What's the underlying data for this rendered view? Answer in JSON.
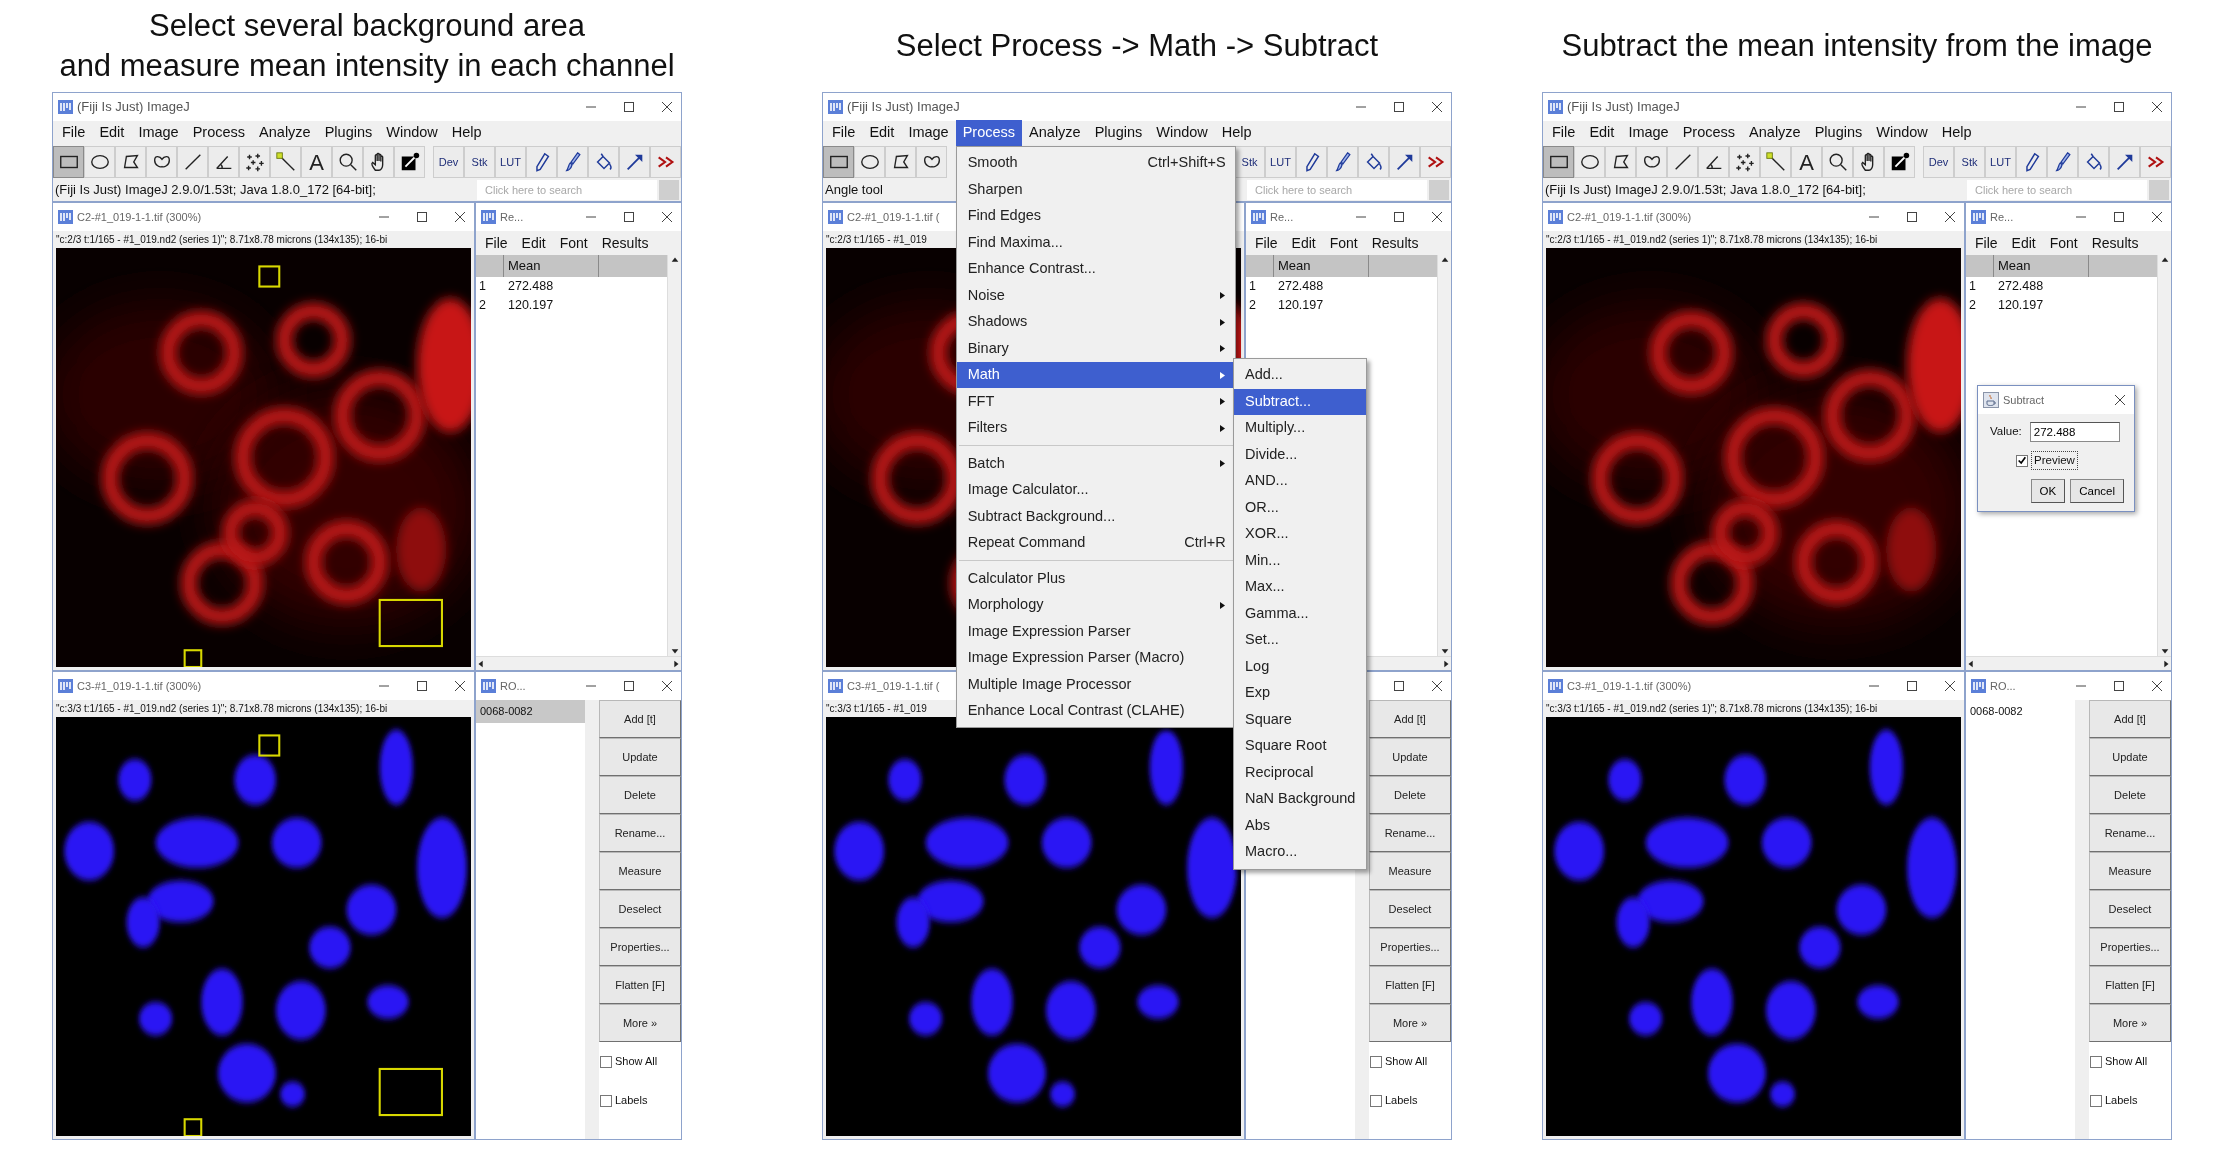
{
  "panels": [
    {
      "caption": [
        "Select several background area",
        "and measure mean intensity in each channel"
      ],
      "main": {
        "title": "(Fiji Is Just) ImageJ",
        "menus": [
          {
            "label": "File",
            "selected": false
          },
          {
            "label": "Edit",
            "selected": false
          },
          {
            "label": "Image",
            "selected": false
          },
          {
            "label": "Process",
            "selected": false
          },
          {
            "label": "Analyze",
            "selected": false
          },
          {
            "label": "Plugins",
            "selected": false
          },
          {
            "label": "Window",
            "selected": false
          },
          {
            "label": "Help",
            "selected": false
          }
        ],
        "tools_left": [
          {
            "kind": "rectangle",
            "selected": true
          },
          {
            "kind": "oval",
            "selected": false
          },
          {
            "kind": "polygon",
            "selected": false
          },
          {
            "kind": "freehand",
            "selected": false
          },
          {
            "kind": "line",
            "selected": false
          },
          {
            "kind": "angle",
            "selected": false
          },
          {
            "kind": "points",
            "selected": false
          },
          {
            "kind": "wand",
            "selected": false
          },
          {
            "kind": "text",
            "label": "A",
            "selected": false
          },
          {
            "kind": "zoom",
            "selected": false
          },
          {
            "kind": "hand",
            "selected": false
          },
          {
            "kind": "dropper",
            "selected": false
          }
        ],
        "tools_right": [
          {
            "kind": "label",
            "label": "Dev",
            "selected": false
          },
          {
            "kind": "label",
            "label": "Stk",
            "selected": false
          },
          {
            "kind": "label",
            "label": "LUT",
            "selected": false
          },
          {
            "kind": "pencil",
            "selected": false
          },
          {
            "kind": "brush",
            "selected": false
          },
          {
            "kind": "fill",
            "selected": false
          },
          {
            "kind": "arrow",
            "selected": false
          },
          {
            "kind": "more",
            "selected": false
          }
        ],
        "status": "(Fiji Is Just) ImageJ 2.9.0/1.53t; Java 1.8.0_172 [64-bit];",
        "search_placeholder": "Click here to search"
      },
      "windows": [
        {
          "title": "C2-#1_019-1-1.tif (300%)",
          "info": "\"c:2/3 t:1/165 - #1_019.nd2 (series 1)\"; 8.71x8.78 microns (134x135); 16-bi",
          "kind": "red",
          "roi_overlay": true
        },
        {
          "title": "C3-#1_019-1-1.tif (300%)",
          "info": "\"c:3/3 t:1/165 - #1_019.nd2 (series 1)\"; 8.71x8.78 microns (134x135); 16-bi",
          "kind": "blue",
          "roi_overlay": true
        }
      ],
      "results": {
        "title": "Re...",
        "menus": [
          "File",
          "Edit",
          "Font",
          "Results"
        ],
        "columns": [
          "Mean"
        ],
        "rows": [
          {
            "number": "1",
            "mean": "272.488"
          },
          {
            "number": "2",
            "mean": "120.197"
          }
        ]
      },
      "roi_manager": {
        "title": "RO...",
        "items": [
          {
            "label": "0068-0082",
            "selected": true
          }
        ],
        "buttons": [
          "Add [t]",
          "Update",
          "Delete",
          "Rename...",
          "Measure",
          "Deselect",
          "Properties...",
          "Flatten [F]",
          "More »"
        ],
        "options": [
          {
            "label": "Show All",
            "checked": false
          },
          {
            "label": "Labels",
            "checked": false
          }
        ]
      }
    },
    {
      "caption": [
        "Select Process -> Math -> Subtract"
      ],
      "main": {
        "title": "(Fiji Is Just) ImageJ",
        "menus": [
          {
            "label": "File",
            "selected": false
          },
          {
            "label": "Edit",
            "selected": false
          },
          {
            "label": "Image",
            "selected": false
          },
          {
            "label": "Process",
            "selected": true
          },
          {
            "label": "Analyze",
            "selected": false
          },
          {
            "label": "Plugins",
            "selected": false
          },
          {
            "label": "Window",
            "selected": false
          },
          {
            "label": "Help",
            "selected": false
          }
        ],
        "tools_left": [
          {
            "kind": "rectangle",
            "selected": true
          },
          {
            "kind": "oval",
            "selected": false
          },
          {
            "kind": "polygon",
            "selected": false
          },
          {
            "kind": "freehand",
            "selected": false
          }
        ],
        "tools_right": [
          {
            "kind": "label",
            "label": "Stk",
            "selected": false
          },
          {
            "kind": "label",
            "label": "LUT",
            "selected": false
          },
          {
            "kind": "pencil",
            "selected": false
          },
          {
            "kind": "brush",
            "selected": false
          },
          {
            "kind": "fill",
            "selected": false
          },
          {
            "kind": "arrow",
            "selected": false
          },
          {
            "kind": "more",
            "selected": false
          }
        ],
        "status": "Angle tool",
        "search_placeholder": "Click here to search"
      },
      "windows": [
        {
          "title": "C2-#1_019-1-1.tif (",
          "info": "\"c:2/3 t:1/165 - #1_019",
          "kind": "red"
        },
        {
          "title": "C3-#1_019-1-1.tif (",
          "info": "\"c:3/3 t:1/165 - #1_019",
          "kind": "blue"
        }
      ],
      "results": {
        "title": "Re...",
        "menus": [
          "File",
          "Edit",
          "Font",
          "Results"
        ],
        "columns": [
          "Mean"
        ],
        "rows": [
          {
            "number": "1",
            "mean": "272.488"
          },
          {
            "number": "2",
            "mean": "120.197"
          }
        ]
      },
      "roi_manager": {
        "buttons": [
          "Add [t]",
          "Update",
          "Delete",
          "Rename...",
          "Measure",
          "Deselect",
          "Properties...",
          "Flatten [F]",
          "More »"
        ],
        "options": [
          {
            "label": "Show All",
            "checked": false
          },
          {
            "label": "Labels",
            "checked": false
          }
        ]
      },
      "menu": {
        "items": [
          {
            "kind": "item",
            "label": "Smooth",
            "shortcut": "Ctrl+Shift+S",
            "has_submenu": false,
            "selected": false
          },
          {
            "kind": "item",
            "label": "Sharpen",
            "has_submenu": false,
            "selected": false
          },
          {
            "kind": "item",
            "label": "Find Edges",
            "has_submenu": false,
            "selected": false
          },
          {
            "kind": "item",
            "label": "Find Maxima...",
            "has_submenu": false,
            "selected": false
          },
          {
            "kind": "item",
            "label": "Enhance Contrast...",
            "has_submenu": false,
            "selected": false
          },
          {
            "kind": "item",
            "label": "Noise",
            "has_submenu": true,
            "selected": false
          },
          {
            "kind": "item",
            "label": "Shadows",
            "has_submenu": true,
            "selected": false
          },
          {
            "kind": "item",
            "label": "Binary",
            "has_submenu": true,
            "selected": false
          },
          {
            "kind": "item",
            "label": "Math",
            "has_submenu": true,
            "selected": true
          },
          {
            "kind": "item",
            "label": "FFT",
            "has_submenu": true,
            "selected": false
          },
          {
            "kind": "item",
            "label": "Filters",
            "has_submenu": true,
            "selected": false
          },
          {
            "kind": "separator"
          },
          {
            "kind": "item",
            "label": "Batch",
            "has_submenu": true,
            "selected": false
          },
          {
            "kind": "item",
            "label": "Image Calculator...",
            "has_submenu": false,
            "selected": false
          },
          {
            "kind": "item",
            "label": "Subtract Background...",
            "has_submenu": false,
            "selected": false
          },
          {
            "kind": "item",
            "label": "Repeat Command",
            "shortcut": "Ctrl+R",
            "has_submenu": false,
            "selected": false
          },
          {
            "kind": "separator"
          },
          {
            "kind": "item",
            "label": "Calculator Plus",
            "has_submenu": false,
            "selected": false
          },
          {
            "kind": "item",
            "label": "Morphology",
            "has_submenu": true,
            "selected": false
          },
          {
            "kind": "item",
            "label": "Image Expression Parser",
            "has_submenu": false,
            "selected": false
          },
          {
            "kind": "item",
            "label": "Image Expression Parser (Macro)",
            "has_submenu": false,
            "selected": false
          },
          {
            "kind": "item",
            "label": "Multiple Image Processor",
            "has_submenu": false,
            "selected": false
          },
          {
            "kind": "item",
            "label": "Enhance Local Contrast (CLAHE)",
            "has_submenu": false,
            "selected": false
          }
        ],
        "submenu_items": [
          {
            "label": "Add...",
            "selected": false
          },
          {
            "label": "Subtract...",
            "selected": true
          },
          {
            "label": "Multiply...",
            "selected": false
          },
          {
            "label": "Divide...",
            "selected": false
          },
          {
            "label": "AND...",
            "selected": false
          },
          {
            "label": "OR...",
            "selected": false
          },
          {
            "label": "XOR...",
            "selected": false
          },
          {
            "label": "Min...",
            "selected": false
          },
          {
            "label": "Max...",
            "selected": false
          },
          {
            "label": "Gamma...",
            "selected": false
          },
          {
            "label": "Set...",
            "selected": false
          },
          {
            "label": "Log",
            "selected": false
          },
          {
            "label": "Exp",
            "selected": false
          },
          {
            "label": "Square",
            "selected": false
          },
          {
            "label": "Square Root",
            "selected": false
          },
          {
            "label": "Reciprocal",
            "selected": false
          },
          {
            "label": "NaN Background",
            "selected": false
          },
          {
            "label": "Abs",
            "selected": false
          },
          {
            "label": "Macro...",
            "selected": false
          }
        ]
      }
    },
    {
      "caption": [
        "Subtract the mean intensity from the image"
      ],
      "main": {
        "title": "(Fiji Is Just) ImageJ",
        "menus": [
          {
            "label": "File",
            "selected": false
          },
          {
            "label": "Edit",
            "selected": false
          },
          {
            "label": "Image",
            "selected": false
          },
          {
            "label": "Process",
            "selected": false
          },
          {
            "label": "Analyze",
            "selected": false
          },
          {
            "label": "Plugins",
            "selected": false
          },
          {
            "label": "Window",
            "selected": false
          },
          {
            "label": "Help",
            "selected": false
          }
        ],
        "tools_left": [
          {
            "kind": "rectangle",
            "selected": true
          },
          {
            "kind": "oval",
            "selected": false
          },
          {
            "kind": "polygon",
            "selected": false
          },
          {
            "kind": "freehand",
            "selected": false
          },
          {
            "kind": "line",
            "selected": false
          },
          {
            "kind": "angle",
            "selected": false
          },
          {
            "kind": "points",
            "selected": false
          },
          {
            "kind": "wand",
            "selected": false
          },
          {
            "kind": "text",
            "label": "A",
            "selected": false
          },
          {
            "kind": "zoom",
            "selected": false
          },
          {
            "kind": "hand",
            "selected": false
          },
          {
            "kind": "dropper",
            "selected": false
          }
        ],
        "tools_right": [
          {
            "kind": "label",
            "label": "Dev",
            "selected": false
          },
          {
            "kind": "label",
            "label": "Stk",
            "selected": false
          },
          {
            "kind": "label",
            "label": "LUT",
            "selected": false
          },
          {
            "kind": "pencil",
            "selected": false
          },
          {
            "kind": "brush",
            "selected": false
          },
          {
            "kind": "fill",
            "selected": false
          },
          {
            "kind": "arrow",
            "selected": false
          },
          {
            "kind": "more",
            "selected": false
          }
        ],
        "status": "(Fiji Is Just) ImageJ 2.9.0/1.53t; Java 1.8.0_172 [64-bit];",
        "search_placeholder": "Click here to search"
      },
      "windows": [
        {
          "title": "C2-#1_019-1-1.tif (300%)",
          "info": "\"c:2/3 t:1/165 - #1_019.nd2 (series 1)\"; 8.71x8.78 microns (134x135); 16-bi",
          "kind": "red"
        },
        {
          "title": "C3-#1_019-1-1.tif (300%)",
          "info": "\"c:3/3 t:1/165 - #1_019.nd2 (series 1)\"; 8.71x8.78 microns (134x135); 16-bi",
          "kind": "blue"
        }
      ],
      "results": {
        "title": "Re...",
        "menus": [
          "File",
          "Edit",
          "Font",
          "Results"
        ],
        "columns": [
          "Mean"
        ],
        "rows": [
          {
            "number": "1",
            "mean": "272.488"
          },
          {
            "number": "2",
            "mean": "120.197"
          }
        ]
      },
      "roi_manager": {
        "title": "RO...",
        "items": [
          {
            "label": "0068-0082",
            "selected": false
          }
        ],
        "buttons": [
          "Add [t]",
          "Update",
          "Delete",
          "Rename...",
          "Measure",
          "Deselect",
          "Properties...",
          "Flatten [F]",
          "More »"
        ],
        "options": [
          {
            "label": "Show All",
            "checked": false
          },
          {
            "label": "Labels",
            "checked": false
          }
        ]
      },
      "dialog": {
        "title": "Subtract",
        "label": "Value:",
        "value": "272.488",
        "preview": {
          "label": "Preview",
          "checked": true
        },
        "buttons": [
          "OK",
          "Cancel"
        ]
      }
    }
  ]
}
